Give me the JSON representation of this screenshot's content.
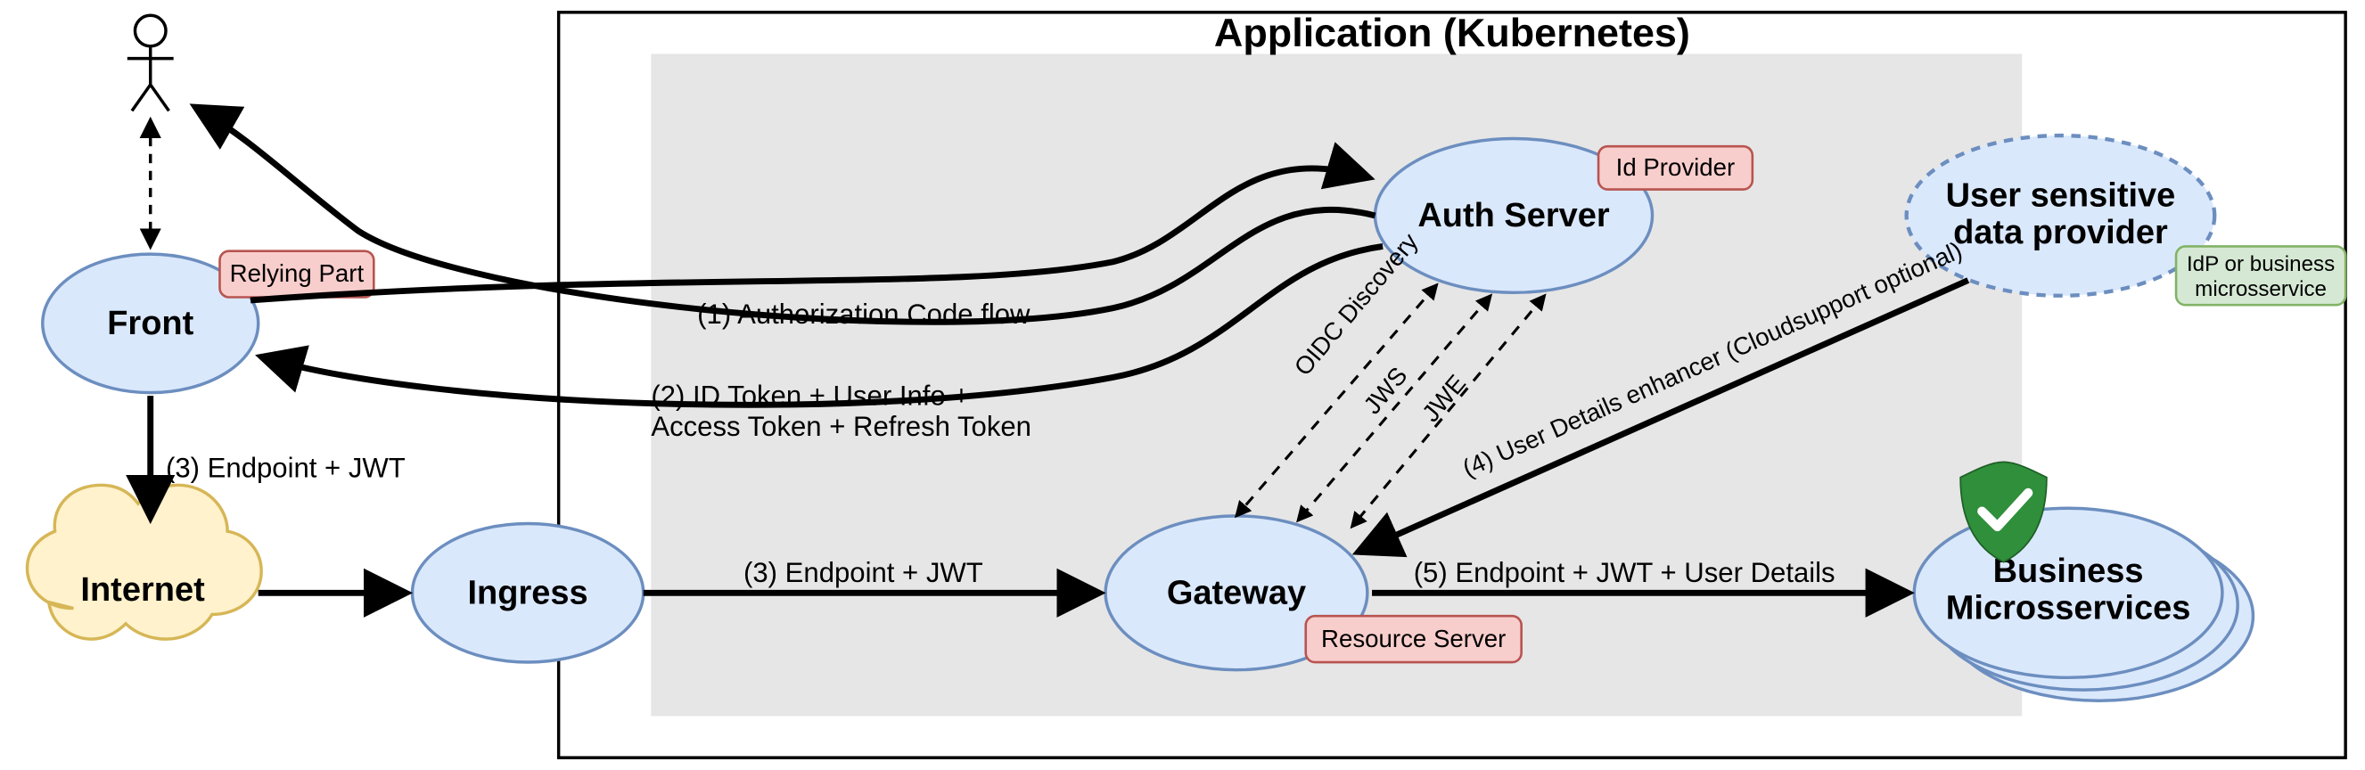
{
  "title": "Application (Kubernetes)",
  "nodes": {
    "front": "Front",
    "internet": "Internet",
    "ingress": "Ingress",
    "gateway": "Gateway",
    "auth_server": "Auth Server",
    "user_sensitive_l1": "User sensitive",
    "user_sensitive_l2": "data provider",
    "business_l1": "Business",
    "business_l2": "Microsservices"
  },
  "badges": {
    "relying_part": "Relying Part",
    "id_provider": "Id Provider",
    "resource_server": "Resource Server",
    "idp_l1": "IdP or business",
    "idp_l2": "microsservice"
  },
  "edges": {
    "e1": "(1) Authorization Code flow",
    "e2_l1": "(2) ID Token + User Info +",
    "e2_l2": "Access Token + Refresh Token",
    "e3a": "(3) Endpoint + JWT",
    "e3b": "(3) Endpoint + JWT",
    "e4": "(4) User Details enhancer (Cloudsupport optional)",
    "e5": "(5) Endpoint + JWT + User Details",
    "oidc": "OIDC Discovery",
    "jws": "JWS",
    "jwe": "JWE"
  }
}
